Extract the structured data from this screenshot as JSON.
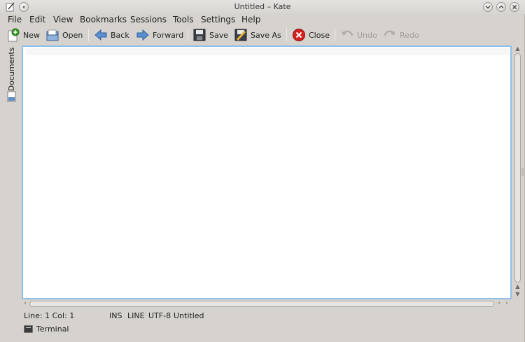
{
  "window": {
    "title": "Untitled – Kate"
  },
  "menubar": {
    "items": [
      {
        "label": "File"
      },
      {
        "label": "Edit"
      },
      {
        "label": "View"
      },
      {
        "label": "Bookmarks"
      },
      {
        "label": "Sessions"
      },
      {
        "label": "Tools"
      },
      {
        "label": "Settings"
      },
      {
        "label": "Help"
      }
    ]
  },
  "toolbar": {
    "new_label": "New",
    "open_label": "Open",
    "back_label": "Back",
    "forward_label": "Forward",
    "save_label": "Save",
    "save_as_label": "Save As",
    "close_label": "Close",
    "undo_label": "Undo",
    "redo_label": "Redo"
  },
  "sidebar": {
    "documents_tab": "Documents"
  },
  "status": {
    "position": "Line: 1 Col: 1",
    "mode": "INS",
    "selection_mode": "LINE",
    "encoding": "UTF-8",
    "document_name": "Untitled"
  },
  "toolviews": {
    "terminal_label": "Terminal"
  }
}
